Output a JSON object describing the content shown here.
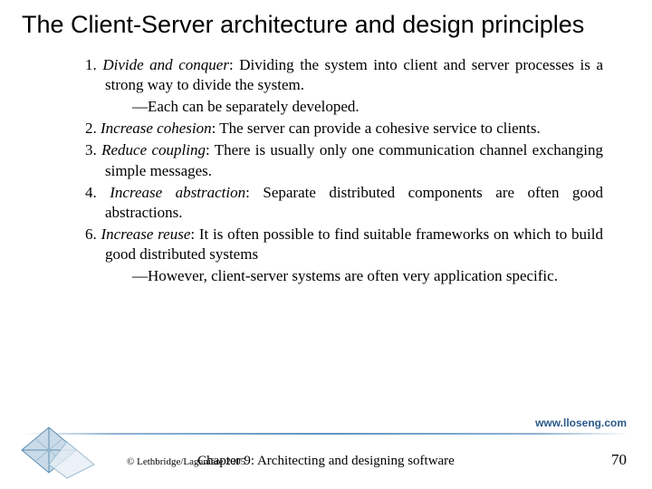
{
  "title": "The Client-Server architecture and design principles",
  "principles": [
    {
      "num": "1.",
      "label": "Divide and conquer",
      "text": ": Dividing the system into client and server processes is a strong way to divide the system.",
      "sub": [
        "—Each can be separately developed."
      ]
    },
    {
      "num": "2.",
      "label": "Increase cohesion",
      "text": ": The server can provide a cohesive service to clients.",
      "sub": []
    },
    {
      "num": "3.",
      "label": "Reduce coupling",
      "text": ": There is usually only one communication channel exchanging simple messages.",
      "sub": []
    },
    {
      "num": "4.",
      "label": "Increase abstraction",
      "text": ": Separate distributed components are often good abstractions.",
      "sub": []
    },
    {
      "num": "6.",
      "label": "Increase reuse",
      "text": ": It is often possible to find suitable frameworks on which to build good distributed systems",
      "sub": [
        "—However, client-server systems are often very application specific."
      ]
    }
  ],
  "url": "www.lloseng.com",
  "copyright": "© Lethbridge/Laganière 2005",
  "chapter": "Chapter 9: Architecting and designing software",
  "page": "70"
}
